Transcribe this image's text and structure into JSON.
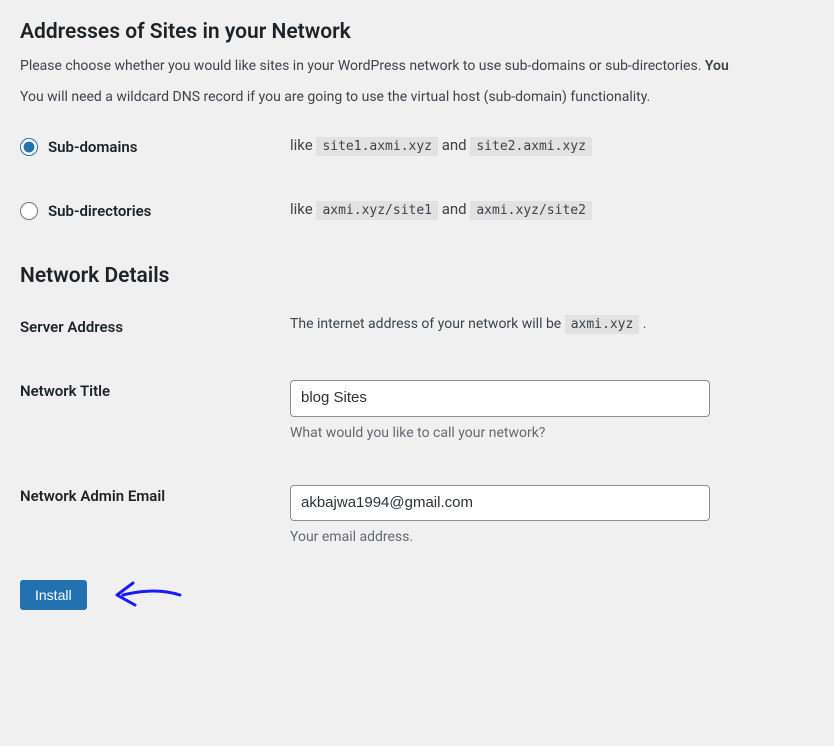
{
  "headings": {
    "addresses": "Addresses of Sites in your Network",
    "network_details": "Network Details"
  },
  "intro": {
    "line1_prefix": "Please choose whether you would like sites in your WordPress network to use sub-domains or sub-directories. ",
    "line1_bold": "You",
    "line2": "You will need a wildcard DNS record if you are going to use the virtual host (sub-domain) functionality."
  },
  "addressing": {
    "subdomains": {
      "label": "Sub-domains",
      "like": "like ",
      "ex1": "site1.axmi.xyz",
      "and": " and ",
      "ex2": "site2.axmi.xyz",
      "checked": true
    },
    "subdirectories": {
      "label": "Sub-directories",
      "like": "like ",
      "ex1": "axmi.xyz/site1",
      "and": " and ",
      "ex2": "axmi.xyz/site2",
      "checked": false
    }
  },
  "details": {
    "server_address": {
      "label": "Server Address",
      "text_before": "The internet address of your network will be ",
      "code": "axmi.xyz",
      "text_after": " ."
    },
    "network_title": {
      "label": "Network Title",
      "value": "blog Sites",
      "help": "What would you like to call your network?"
    },
    "admin_email": {
      "label": "Network Admin Email",
      "value": "akbajwa1994@gmail.com",
      "help": "Your email address."
    }
  },
  "actions": {
    "install": "Install"
  }
}
